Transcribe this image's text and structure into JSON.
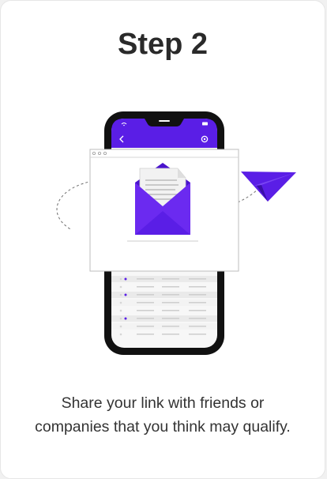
{
  "step": {
    "title": "Step 2",
    "caption": "Share your link with friends or companies that you think may qualify."
  },
  "colors": {
    "accent": "#5a1ee6",
    "phone_frame": "#111111",
    "title_text": "#2a2a2a"
  },
  "icons": [
    "phone-illustration",
    "back-arrow-icon",
    "settings-icon",
    "wifi-icon",
    "battery-icon",
    "browser-window",
    "envelope-icon",
    "document-icon",
    "paper-plane-icon"
  ]
}
